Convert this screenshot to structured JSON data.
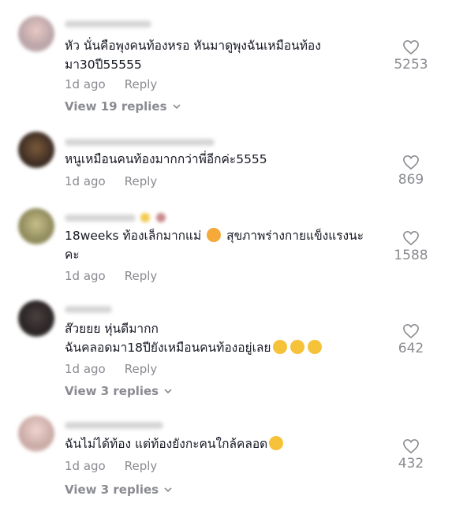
{
  "comments": [
    {
      "text_lines": [
        "หัว นั่นคือพุงคนท้องหรอ หันมาดูพุงฉันเหมือนท้อง",
        "มา30ปี55555"
      ],
      "time": "1d ago",
      "reply_label": "Reply",
      "likes": "5253",
      "view_replies": "View 19 replies"
    },
    {
      "text_lines": [
        "หนูเหมือนคนท้องมากกว่าพี่อีกค่ะ5555"
      ],
      "time": "1d ago",
      "reply_label": "Reply",
      "likes": "869"
    },
    {
      "text_lines": [
        "18weeks ท้องเล็กมากแม่",
        "สุขภาพร่างกายแข็งแรงนะ",
        "คะ"
      ],
      "time": "1d ago",
      "reply_label": "Reply",
      "likes": "1588"
    },
    {
      "text_lines": [
        "ส๊วยยย หุ่นดีมากก",
        "ฉันคลอดมา18ปียังเหมือนคนท้องอยู่เลย"
      ],
      "time": "1d ago",
      "reply_label": "Reply",
      "likes": "642",
      "view_replies": "View 3 replies"
    },
    {
      "text_lines": [
        "ฉันไม่ได้ท้อง แต่ท้องยังกะคนใกล้คลอด"
      ],
      "time": "1d ago",
      "reply_label": "Reply",
      "likes": "432",
      "view_replies": "View 3 replies"
    }
  ],
  "icons": {
    "like": "heart-outline-icon",
    "expand": "chevron-down-icon"
  },
  "colors": {
    "text": "#161823",
    "secondary": "#8a8b91"
  }
}
